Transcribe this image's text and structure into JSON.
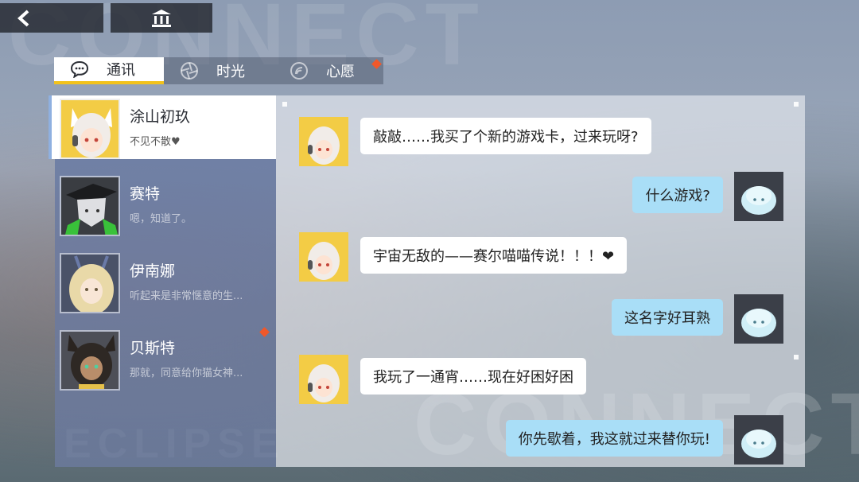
{
  "tabs": [
    {
      "label": "通讯",
      "icon": "chat-icon",
      "active": true
    },
    {
      "label": "时光",
      "icon": "aperture-icon",
      "active": false
    },
    {
      "label": "心愿",
      "icon": "wish-icon",
      "active": false,
      "badge": true
    }
  ],
  "contacts": [
    {
      "name": "涂山初玖",
      "preview": "不见不散♥",
      "active": true
    },
    {
      "name": "赛特",
      "preview": "嗯，知道了。",
      "active": false
    },
    {
      "name": "伊南娜",
      "preview": "听起来是非常惬意的生...",
      "active": false
    },
    {
      "name": "贝斯特",
      "preview": "那就，同意给你猫女神...",
      "active": false,
      "badge": true
    }
  ],
  "messages": [
    {
      "side": "left",
      "text": "敲敲……我买了个新的游戏卡，过来玩呀?"
    },
    {
      "side": "right",
      "text": "什么游戏?"
    },
    {
      "side": "left",
      "text": "宇宙无敌的——赛尔喵喵传说！！！❤"
    },
    {
      "side": "right",
      "text": "这名字好耳熟"
    },
    {
      "side": "left",
      "text": "我玩了一通宵……现在好困好困"
    },
    {
      "side": "right",
      "text": "你先歇着，我这就过来替你玩!"
    }
  ],
  "colors": {
    "accent_yellow": "#f2c21b",
    "badge_red": "#f0582a",
    "bubble_self": "#a9def7",
    "bubble_other": "#ffffff"
  }
}
